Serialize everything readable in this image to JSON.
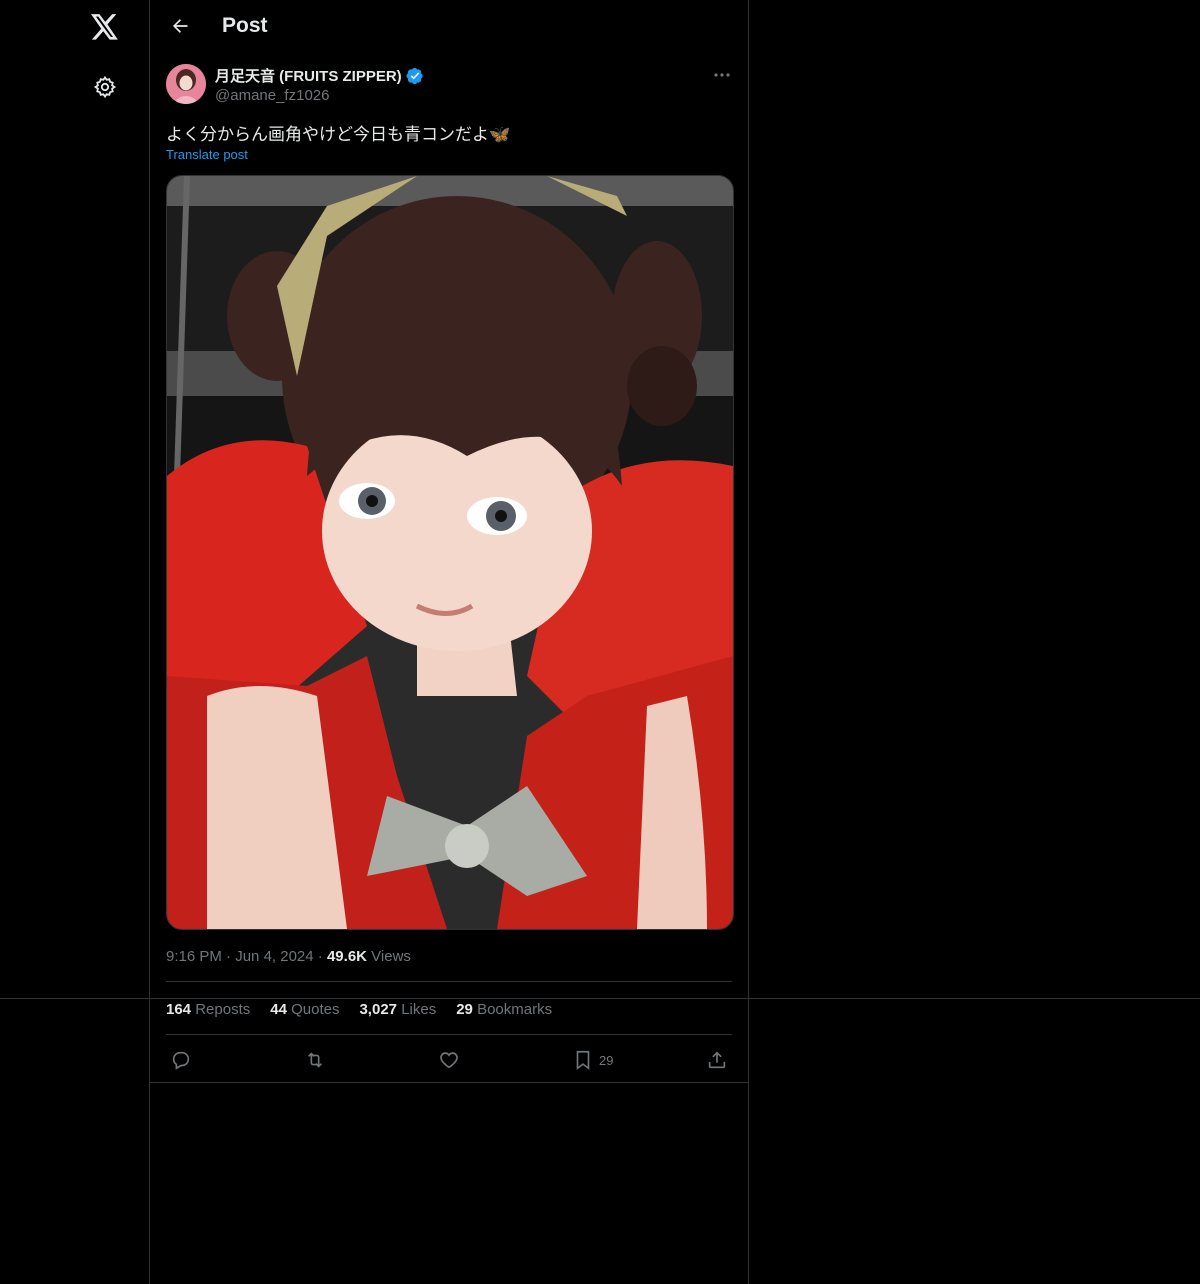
{
  "nav": {
    "logo_icon": "x-logo-icon",
    "settings_icon": "gear-icon"
  },
  "header": {
    "title": "Post",
    "back_icon": "arrow-left-icon"
  },
  "author": {
    "display_name": "月足天音 (FRUITS ZIPPER)",
    "handle": "@amane_fz1026",
    "verified_icon": "verified-badge-icon",
    "verified_color": "#1d9bf0"
  },
  "post": {
    "text": "よく分からん画角やけど今日も青コンだよ🦋",
    "translate_label": "Translate post",
    "media_icon": "photo"
  },
  "meta": {
    "time": "9:16 PM",
    "date": "Jun 4, 2024",
    "views_count": "49.6K",
    "views_label": "Views"
  },
  "stats": {
    "reposts_count": "164",
    "reposts_label": "Reposts",
    "quotes_count": "44",
    "quotes_label": "Quotes",
    "likes_count": "3,027",
    "likes_label": "Likes",
    "bookmarks_count": "29",
    "bookmarks_label": "Bookmarks"
  },
  "actions": {
    "reply_icon": "reply-icon",
    "repost_icon": "repost-icon",
    "like_icon": "heart-icon",
    "bookmark_icon": "bookmark-icon",
    "bookmark_count": "29",
    "share_icon": "share-icon"
  },
  "colors": {
    "background": "#000000",
    "text": "#e7e9ea",
    "muted": "#71767b",
    "accent": "#1d9bf0",
    "border": "#2f3336"
  }
}
